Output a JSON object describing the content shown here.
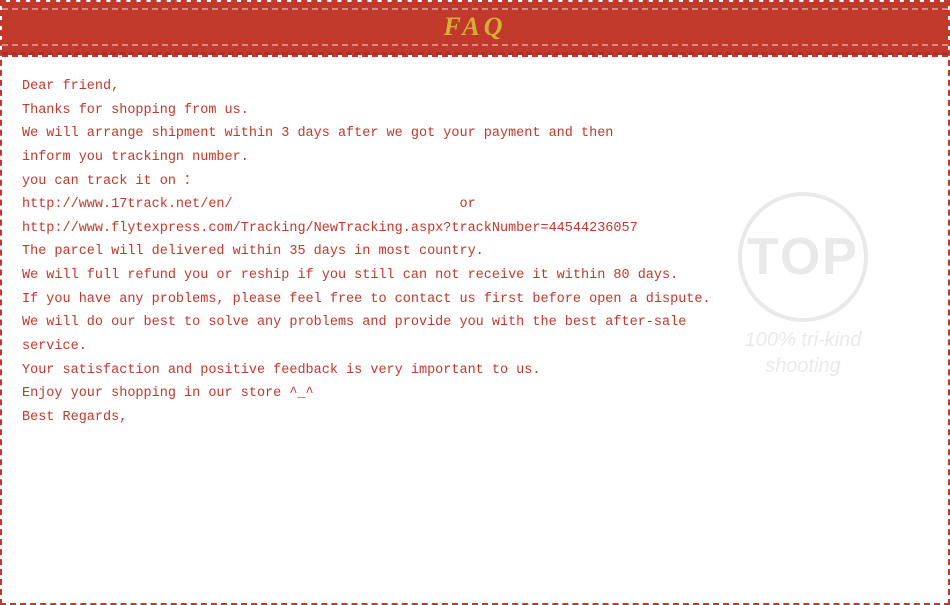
{
  "header": {
    "title": "FAQ",
    "bg_color": "#c0392b",
    "title_color": "#d4af37"
  },
  "content": {
    "lines": [
      "Dear friend,",
      "Thanks for shopping from us.",
      "We will arrange shipment within 3 days after we got your payment and then",
      "inform you trackingn number.",
      "you can track it on ：",
      "http://www.17track.net/en/                            or",
      "http://www.flytexpress.com/Tracking/NewTracking.aspx?trackNumber=44544236057",
      "The parcel will delivered within 35 days in most country.",
      "We will full refund you or reship if you still can not receive it within 80 days.",
      "If you have any problems, please feel free to contact us first before open a dispute.",
      "We will do our best to solve any problems and provide you with the best after-sale",
      "service.",
      "Your satisfaction and positive feedback is very important to us.",
      "Enjoy your shopping in our store ^_^",
      "Best Regards,"
    ]
  },
  "watermark": {
    "circle_text": "TOP",
    "line1": "100% tri-kind",
    "line2": "shooting"
  }
}
